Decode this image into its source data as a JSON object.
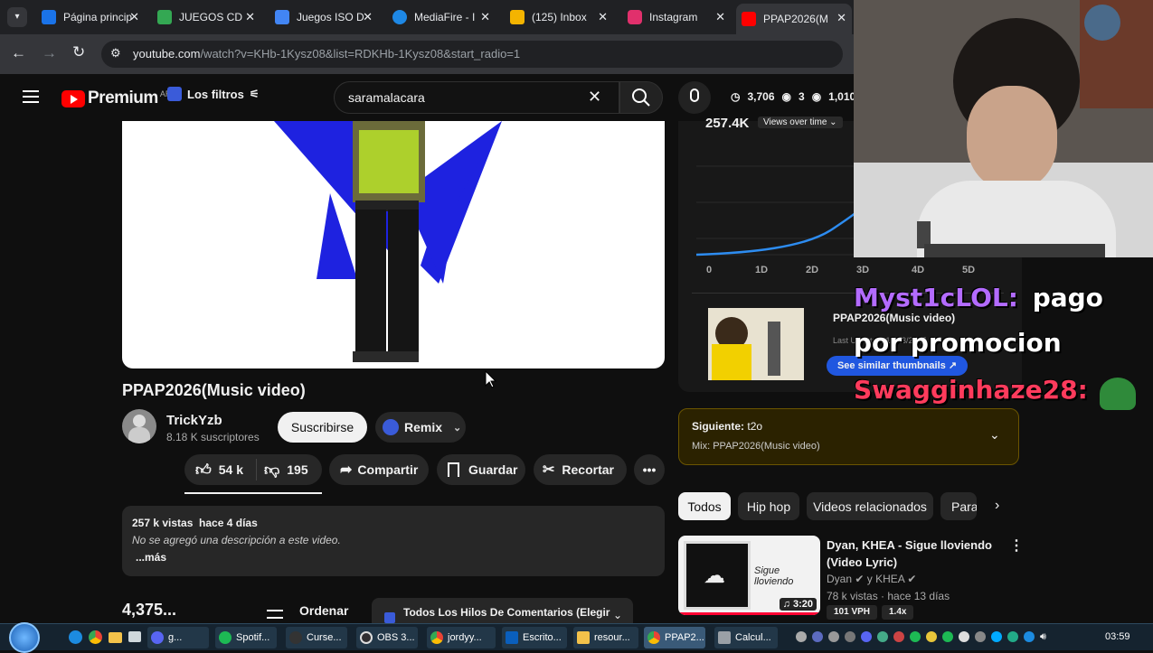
{
  "browser": {
    "tabs": [
      {
        "title": "Página principal",
        "color": "#1a73e8"
      },
      {
        "title": "JUEGOS CD",
        "color": "#34a853"
      },
      {
        "title": "Juegos ISO D",
        "color": "#4285f4"
      },
      {
        "title": "MediaFire - I",
        "color": "#1e88e5"
      },
      {
        "title": "(125) Inbox",
        "color": "#f4b400"
      },
      {
        "title": "Instagram",
        "color": "#e1306c"
      },
      {
        "title": "PPAP2026(M",
        "color": "#ff0000"
      }
    ],
    "url_host": "youtube.com",
    "url_path": "/watch?v=KHb-1Kysz08&list=RDKHb-1Kysz08&start_radio=1"
  },
  "youtube": {
    "logo": "Premium",
    "region": "AR",
    "filters_label": "Los filtros",
    "search_value": "saramalacara",
    "ext_stats": {
      "a": "3,706",
      "b": "3",
      "c": "1,010"
    }
  },
  "video": {
    "title": "PPAP2026(Music video)",
    "channel": "TrickYzb",
    "subscribers": "8.18 K suscriptores",
    "subscribe_label": "Suscribirse",
    "remix_label": "Remix",
    "likes": "54 k",
    "dislikes": "195",
    "share_label": "Compartir",
    "save_label": "Guardar",
    "clip_label": "Recortar",
    "views_date": "257 k vistas  hace 4 días",
    "description": "No se agregó una descripción a este video.",
    "more_label": "...más",
    "comments_count": "4,375...",
    "sort_label": "Ordenar",
    "comment_filter": "Todos Los Hilos De Comentarios (Elegir"
  },
  "stats_panel": {
    "views": "257.4K",
    "dropdown": "Views over time",
    "axis": [
      "0",
      "1D",
      "2D",
      "3D",
      "4D",
      "5D"
    ],
    "y0": "0",
    "thumb_title": "PPAP2026(Music video)",
    "last_updated": "Last Updated: 12/13/2025",
    "similar_label": "See similar thumbnails ↗"
  },
  "next": {
    "label": "Siguiente:",
    "track": "t2o",
    "mix": "Mix: PPAP2026(Music video)"
  },
  "chips": [
    "Todos",
    "Hip hop",
    "Videos relacionados",
    "Para"
  ],
  "related": {
    "title": "Dyan, KHEA - Sigue lloviendo (Video Lyric)",
    "channel": "Dyan ✔ y KHEA ✔",
    "meta": "78 k vistas · hace 13 días",
    "duration": "♫ 3:20",
    "vph": "101 VPH",
    "ratio": "1.4x",
    "thumb_text": "Sigue lloviendo"
  },
  "chat": [
    {
      "user": "Myst1cLOL:",
      "msg": "pago",
      "color": "#b36bff"
    },
    {
      "user": "",
      "msg": "por promocion",
      "color": "#ffffff"
    },
    {
      "user": "Swagginhaze28:",
      "msg": "",
      "color": "#ff3b5c"
    }
  ],
  "taskbar": {
    "items": [
      "g...",
      "Spotif...",
      "Curse...",
      "OBS 3...",
      "jordyy...",
      "Escrito...",
      "resour...",
      "PPAP2...",
      "Calcul..."
    ],
    "clock": "03:59"
  }
}
